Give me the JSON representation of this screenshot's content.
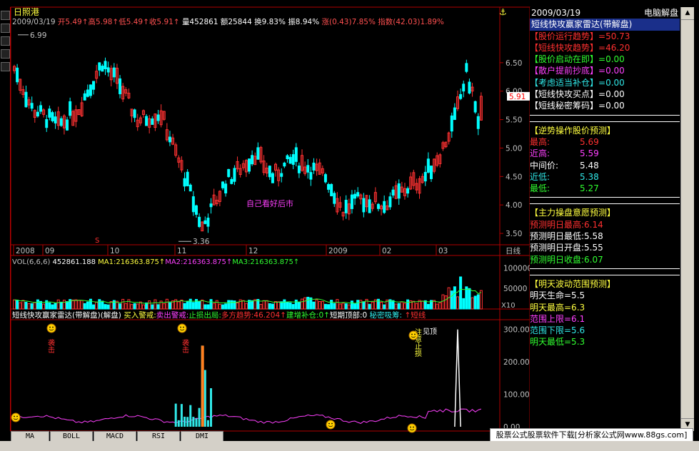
{
  "header": {
    "stock_name": "日照港",
    "date": "2009/03/19",
    "open_label": "开",
    "open": "5.49",
    "high_label": "高",
    "high": "5.98",
    "low_label": "低",
    "low": "5.49",
    "close_label": "收",
    "close": "5.91",
    "volume_label": "量",
    "volume": "452861",
    "amount_label": "额",
    "amount": "25844",
    "turnover_label": "换",
    "turnover": "9.83%",
    "amplitude_label": "振",
    "amplitude": "8.94%",
    "change_label": "涨",
    "change": "(0.43)",
    "change_pct": "7.85%",
    "index_label": "指数",
    "index_change": "(42.03)",
    "index_pct": "1.89%",
    "anchor_icon": "anchor-icon"
  },
  "main_chart": {
    "max_label": "6.99",
    "min_label": "3.36",
    "annotation": "自己看好后市",
    "buy_marker": "S",
    "current_price_tag": "5.91",
    "y_ticks": [
      "6.50",
      "6.00",
      "5.50",
      "5.00",
      "4.50",
      "4.00",
      "3.50"
    ],
    "x_ticks": [
      "2008",
      "09",
      "10",
      "11",
      "12",
      "2009",
      "02",
      "03"
    ],
    "x_axis_unit": "日线"
  },
  "volume_panel": {
    "title": "VOL(6,6,6)",
    "value": "452861.188",
    "ma1_label": "MA1:216363.875",
    "ma2_label": "MA2:216363.875",
    "ma3_label": "MA3:216363.875",
    "y_ticks": [
      "100000",
      "50000"
    ],
    "unit": "X10"
  },
  "indicator_panel": {
    "title": "短线快攻赢家雷达(带解盘)(解盘)",
    "signal_buy_alert": "买入警戒",
    "signal_sell_alert": "卖出警戒",
    "signal_stop_loss": "止损出局",
    "signal_trend": "多方趋势:46.204",
    "signal_add": "建增补仓:0",
    "signal_top": "短期顶部:0",
    "signal_accumulate": "秘密吸筹:",
    "signal_quick": "短线",
    "y_ticks": [
      "300.00",
      "200.00",
      "100.00",
      "0.00"
    ],
    "label_attack_1": "袭击",
    "label_attack_2": "袭击",
    "label_stop": "注意止损",
    "label_top": "见顶"
  },
  "sidebar": {
    "date": "2009/03/19",
    "mode": "电脑解盘",
    "title": "短线快攻赢家雷达(带解盘)",
    "rows1": [
      {
        "label": "【股价运行趋势】",
        "value": "=50.73",
        "color": "#ff3030"
      },
      {
        "label": "【短线快攻趋势】",
        "value": "=46.20",
        "color": "#ff3030"
      },
      {
        "label": "【股价启动在即】",
        "value": "=0.00",
        "color": "#30ff30"
      },
      {
        "label": "【散户提前抄底】",
        "value": "=0.00",
        "color": "#ff40ff"
      },
      {
        "label": "【考虑适当补仓】",
        "value": "=0.00",
        "color": "#30e8e8"
      },
      {
        "label": "【短线快攻买点】",
        "value": "=0.00",
        "color": "#ffffff"
      },
      {
        "label": "【短线秘密筹码】",
        "value": "=0.00",
        "color": "#ffffff"
      }
    ],
    "section2_title": "【逆势操作股价预测】",
    "rows2": [
      {
        "label": "最高:",
        "value": "5.69",
        "color": "#ff3030"
      },
      {
        "label": "近高:",
        "value": "5.59",
        "color": "#ff40ff"
      },
      {
        "label": "中间价:",
        "value": "5.48",
        "color": "#ffffff"
      },
      {
        "label": "近低:",
        "value": "5.38",
        "color": "#30e8e8"
      },
      {
        "label": "最低:",
        "value": "5.27",
        "color": "#30ff30"
      }
    ],
    "section3_title": "【主力操盘意愿预测】",
    "rows3": [
      {
        "text": "预测明日最高:6.14",
        "color": "#ff3030"
      },
      {
        "text": "预测明日最低:5.58",
        "color": "#ffffff"
      },
      {
        "text": "预测明日开盘:5.55",
        "color": "#ffffff"
      },
      {
        "text": "预测明日收盘:6.07",
        "color": "#30ff30"
      }
    ],
    "section4_title": "【明天波动范围预测】",
    "rows4": [
      {
        "text": "明天生命=5.5",
        "color": "#ffffff"
      },
      {
        "text": "明天最高=6.3",
        "color": "#ffff40"
      },
      {
        "text": "范围上限=6.1",
        "color": "#ff40ff"
      },
      {
        "text": "范围下限=5.6",
        "color": "#30e8e8"
      },
      {
        "text": "明天最低=5.3",
        "color": "#30ff30"
      }
    ]
  },
  "tabs": [
    "MA",
    "BOLL",
    "MACD",
    "RSI",
    "DMI"
  ],
  "footer": "股票公式股票软件下载[分析家公式网www.88gs.com]",
  "colors": {
    "up": "#ff3232",
    "down": "#00ffff",
    "grid": "#b00000",
    "axis_text": "#c0c0c0"
  },
  "chart_data": {
    "type": "candlestick",
    "x": [
      "2008-08",
      "2008-09",
      "2008-10",
      "2008-11",
      "2008-12",
      "2009-01",
      "2009-02",
      "2009-03"
    ],
    "price_max": 6.99,
    "price_min": 3.36,
    "last_close": 5.91,
    "ylim": [
      3.3,
      7.0
    ],
    "volume_ylim": [
      0,
      130000
    ],
    "indicator_ylim": [
      0,
      330
    ],
    "indicator_value": 46.204
  }
}
